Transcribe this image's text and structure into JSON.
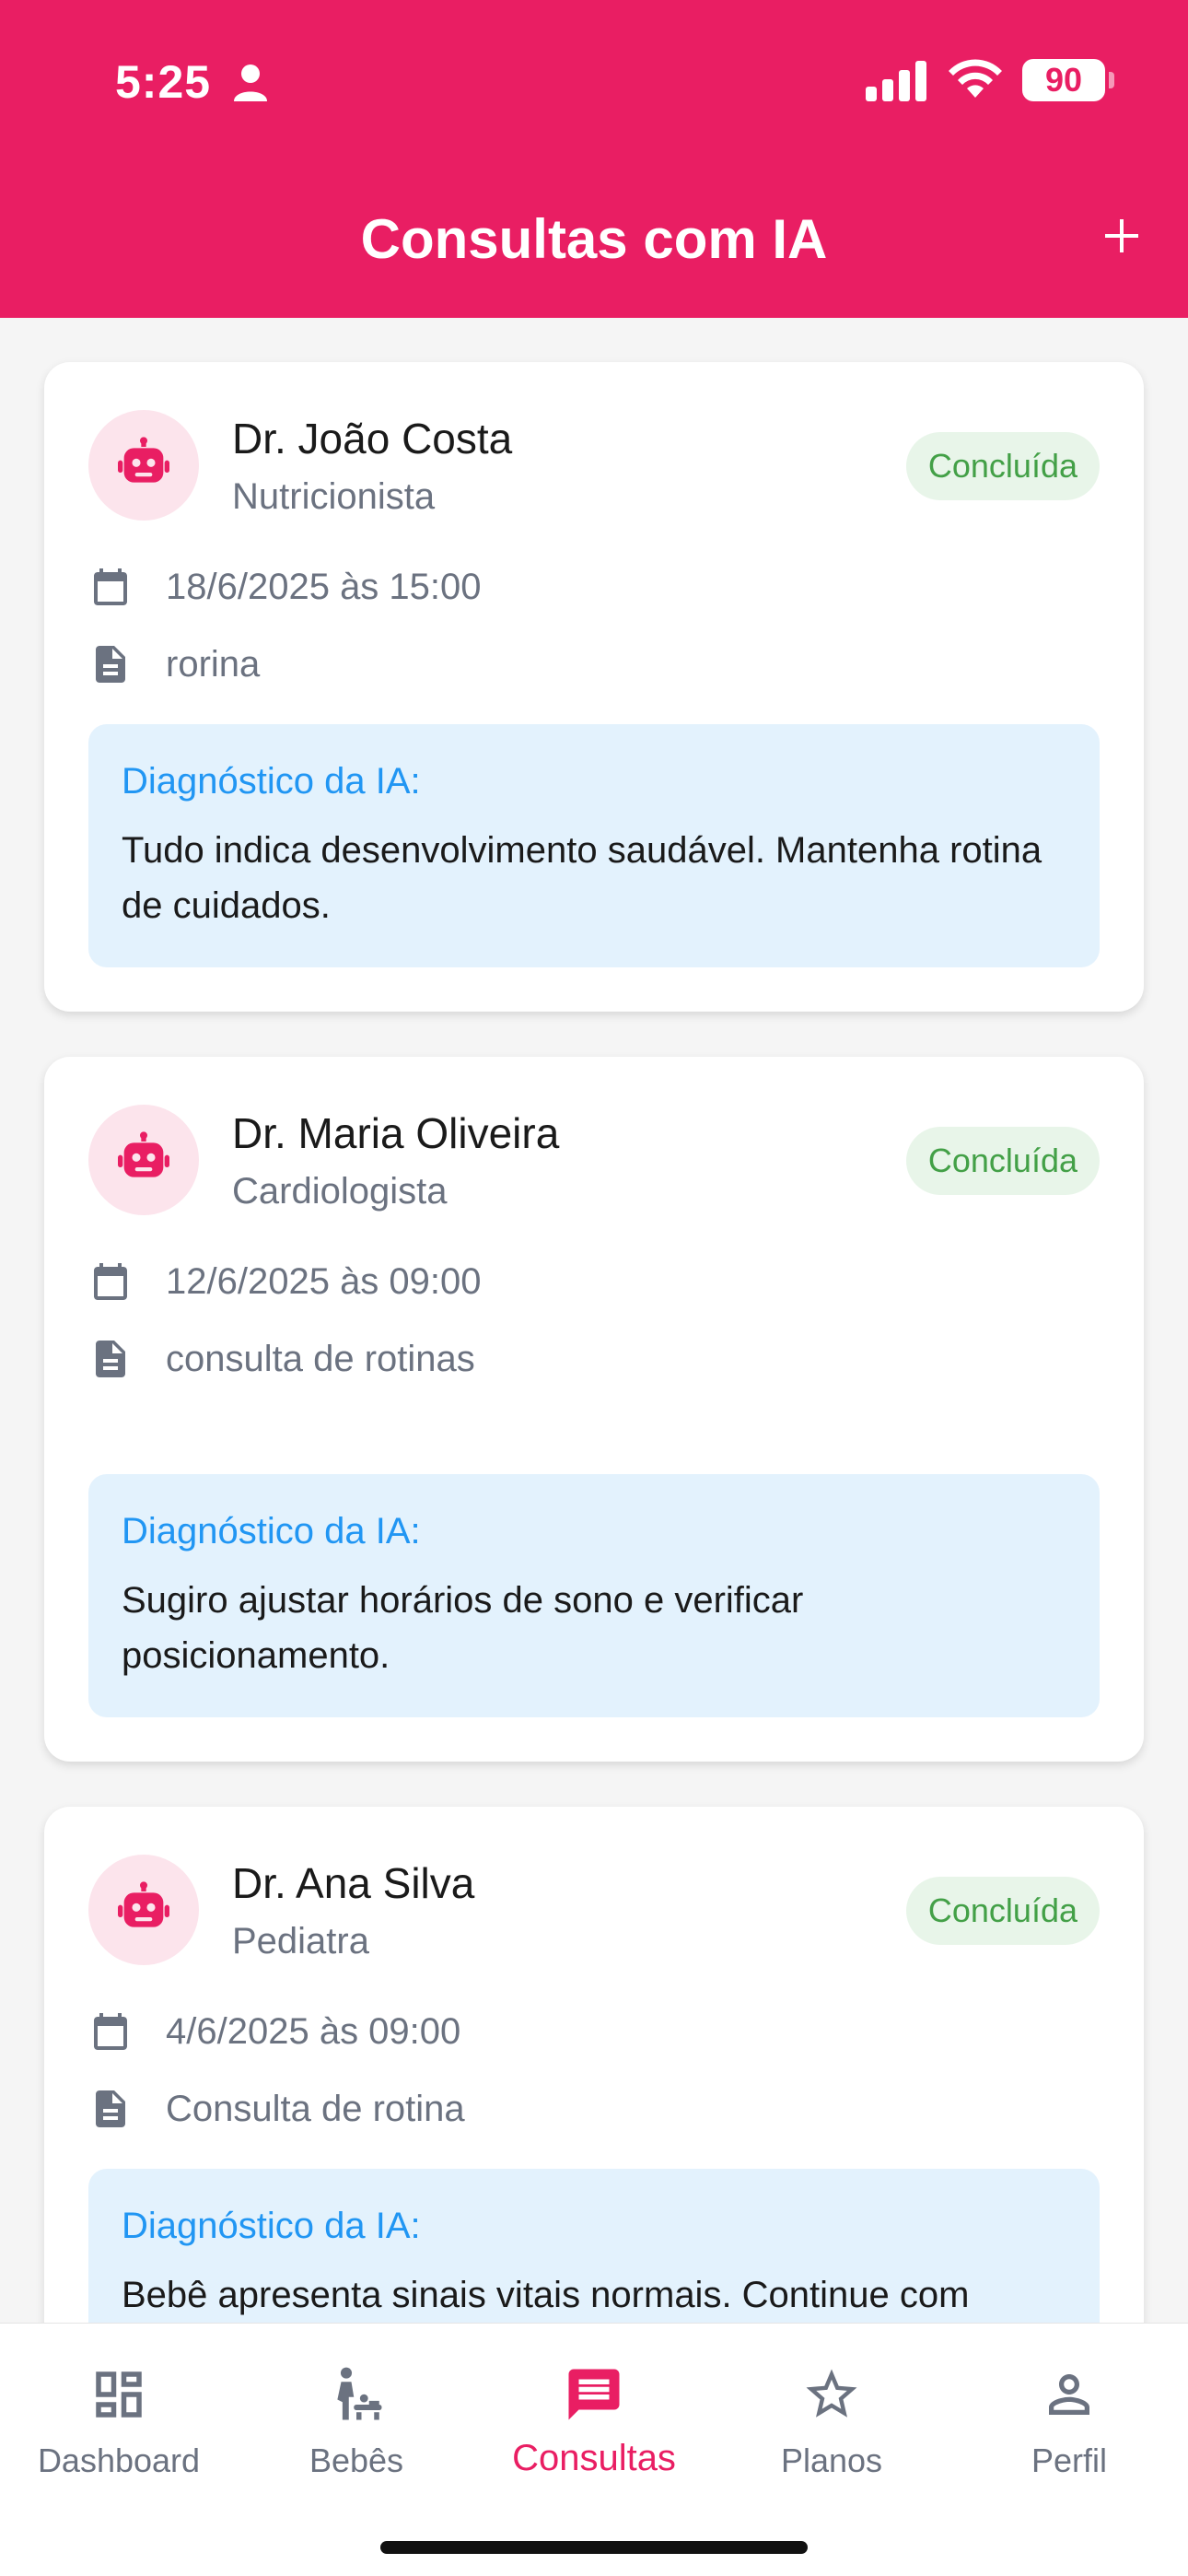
{
  "status_bar": {
    "time": "5:25",
    "battery": "90"
  },
  "header": {
    "title": "Consultas com IA"
  },
  "consultations": [
    {
      "doctor": "Dr. João Costa",
      "specialty": "Nutricionista",
      "status": "Concluída",
      "datetime": "18/6/2025 às 15:00",
      "notes": "rorina",
      "ai_label": "Diagnóstico da IA:",
      "ai_text": "Tudo indica desenvolvimento saudável. Mantenha rotina de cuidados."
    },
    {
      "doctor": "Dr. Maria Oliveira",
      "specialty": "Cardiologista",
      "status": "Concluída",
      "datetime": "12/6/2025 às 09:00",
      "notes": "consulta de rotinas",
      "ai_label": "Diagnóstico da IA:",
      "ai_text": "Sugiro ajustar horários de sono e verificar posicionamento."
    },
    {
      "doctor": "Dr. Ana Silva",
      "specialty": "Pediatra",
      "status": "Concluída",
      "datetime": "4/6/2025 às 09:00",
      "notes": "Consulta de rotina",
      "ai_label": "Diagnóstico da IA:",
      "ai_text": "Bebê apresenta sinais vitais normais. Continue com"
    }
  ],
  "nav": {
    "items": [
      {
        "label": "Dashboard",
        "icon": "dashboard-icon"
      },
      {
        "label": "Bebês",
        "icon": "baby-icon"
      },
      {
        "label": "Consultas",
        "icon": "chat-icon",
        "active": true
      },
      {
        "label": "Planos",
        "icon": "star-icon"
      },
      {
        "label": "Perfil",
        "icon": "person-icon"
      }
    ]
  },
  "colors": {
    "primary": "#e91e63",
    "badge_bg": "#e8f5e9",
    "badge_text": "#43a047",
    "ai_box_bg": "#e3f2fd",
    "ai_label": "#2196f3"
  }
}
